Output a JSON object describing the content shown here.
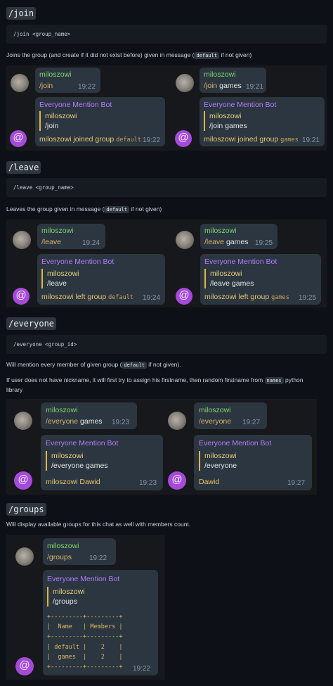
{
  "sections": {
    "join": {
      "heading": "/join",
      "usage": "/join <group_name>",
      "desc_pre": "Joins the group (and create if it did not exist before) given in message (",
      "desc_code": "default",
      "desc_post": " if not given)",
      "left": {
        "user": "miloszowi",
        "cmd": "/join",
        "cmd_time": "19:22",
        "bot": "Everyone Mention Bot",
        "quote_name": "miloszowi",
        "quote_text": "/join",
        "reply_pre": "miloszowi joined group ",
        "reply_code": "default",
        "reply_time": "19:22"
      },
      "right": {
        "user": "miloszowi",
        "cmd": "/join",
        "cmd_arg": " games",
        "cmd_time": "19:21",
        "bot": "Everyone Mention Bot",
        "quote_name": "miloszowi",
        "quote_text": "/join games",
        "reply_pre": "miloszowi joined group ",
        "reply_code": "games",
        "reply_time": "19:21"
      }
    },
    "leave": {
      "heading": "/leave",
      "usage": "/leave <group_name>",
      "desc_pre": "Leaves the group given in message (",
      "desc_code": "default",
      "desc_post": " if not given)",
      "left": {
        "user": "miloszowi",
        "cmd": "/leave",
        "cmd_time": "19:24",
        "bot": "Everyone Mention Bot",
        "quote_name": "miloszowi",
        "quote_text": "/leave",
        "reply_pre": "miloszowi left group ",
        "reply_code": "default",
        "reply_time": "19:24"
      },
      "right": {
        "user": "miloszowi",
        "cmd": "/leave",
        "cmd_arg": " games",
        "cmd_time": "19:25",
        "bot": "Everyone Mention Bot",
        "quote_name": "miloszowi",
        "quote_text": "/leave games",
        "reply_pre": "miloszowi left group ",
        "reply_code": "games",
        "reply_time": "19:25"
      }
    },
    "everyone": {
      "heading": "/everyone",
      "usage": "/everyone <group_id>",
      "desc_pre": "Will mention every member of given group (",
      "desc_code": "default",
      "desc_post": " if not given).",
      "desc2_pre": "If user does not have nickname, it will first try to assign his firstname, then random firstname from ",
      "desc2_code": "names",
      "desc2_post": " python",
      "desc2_line2": "library",
      "left": {
        "user": "miloszowi",
        "cmd": "/everyone",
        "cmd_arg": " games",
        "cmd_time": "19:23",
        "bot": "Everyone Mention Bot",
        "quote_name": "miloszowi",
        "quote_text": "/everyone games",
        "reply": "miloszowi Dawid",
        "reply_time": "19:23"
      },
      "right": {
        "user": "miloszowi",
        "cmd": "/everyone",
        "cmd_time": "19:27",
        "bot": "Everyone Mention Bot",
        "quote_name": "miloszowi",
        "quote_text": "/everyone",
        "reply": "Dawid",
        "reply_time": "19:27"
      }
    },
    "groups": {
      "heading": "/groups",
      "desc": "Will display available groups for this chat as well with members count.",
      "chat": {
        "user": "miloszowi",
        "cmd": "/groups",
        "cmd_time": "19:22",
        "bot": "Everyone Mention Bot",
        "quote_name": "miloszowi",
        "quote_text": "/groups",
        "table": "+---------+---------+\n|  Name   | Members |\n+---------+---------+\n| default |    2    |\n|  games  |    2    |\n+---------+---------+",
        "reply_time": "19:22"
      }
    }
  },
  "icons": {
    "bot_avatar": "at-sign-icon",
    "user_avatar": "user-photo"
  }
}
